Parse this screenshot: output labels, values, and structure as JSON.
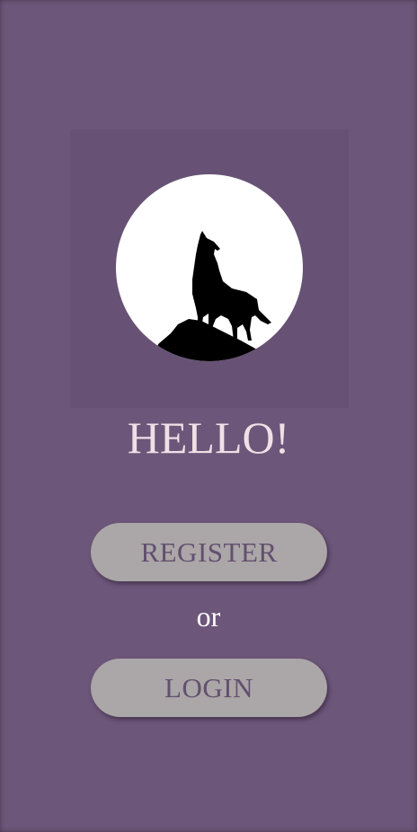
{
  "logo": {
    "icon": "howling-wolf-moon-icon",
    "moon_color": "#ffffff",
    "silhouette_color": "#000000"
  },
  "greeting": "HELLO!",
  "actions": {
    "register_label": "REGISTER",
    "separator": "or",
    "login_label": "LOGIN"
  },
  "colors": {
    "background": "#6c5679",
    "logo_panel": "#675275",
    "button_bg": "#aba6a7",
    "button_text": "#62506f",
    "greeting_text": "#f1dfe6",
    "separator_text": "#ffffff"
  }
}
